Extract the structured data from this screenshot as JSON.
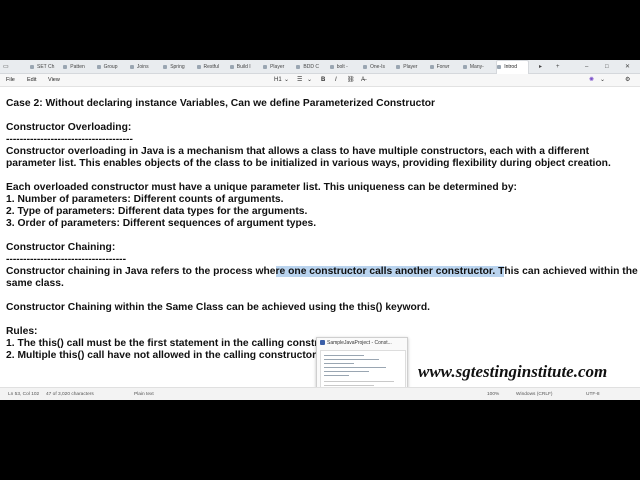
{
  "tabs": [
    "SET Ch",
    "Patten",
    "Group",
    "Joins",
    "Spring",
    "Restful",
    "Build I",
    "Player",
    "BDD C",
    "bolt -",
    "One-Is",
    "Player",
    "Forwr",
    "Many-",
    "Introd"
  ],
  "active_tab_index": 14,
  "window_controls": {
    "new_tab": "+",
    "minimize": "–",
    "maximize": "□",
    "close": "✕"
  },
  "menu": {
    "file": "File",
    "edit": "Edit",
    "view": "View"
  },
  "toolbar": {
    "heading": "H1",
    "list": "☰",
    "bold": "B",
    "italic": "I",
    "link": "⛓",
    "clear": "A̶"
  },
  "document": {
    "lines": [
      {
        "text": "Case 2: Without declaring instance Variables, Can we define Parameterized Constructor"
      },
      {
        "text": "Constructor Overloading:"
      },
      {
        "text": "-------------------------------------"
      },
      {
        "text": "Constructor overloading in Java is a mechanism that allows a class to have multiple constructors, each with a different"
      },
      {
        "text": "parameter list. This enables objects of the class to be initialized in various ways, providing flexibility during object creation."
      },
      {
        "text": "Each overloaded constructor must have a unique parameter list. This uniqueness can be determined by:"
      },
      {
        "text": "1. Number of parameters: Different counts of arguments."
      },
      {
        "text": "2. Type of parameters: Different data types for the arguments."
      },
      {
        "text": "3. Order of parameters: Different sequences of argument types."
      },
      {
        "text": "Constructor Chaining:"
      },
      {
        "text": "-----------------------------------"
      },
      {
        "text": "Constructor chaining in Java refers to the process where one constructor calls another constructor. This can achieved  within the"
      },
      {
        "text": "same class."
      },
      {
        "text": "Constructor Chaining within the Same Class can be achieved using the this() keyword."
      },
      {
        "text": "Rules:"
      },
      {
        "text": "1. The this() call must be the first statement in the calling constr"
      },
      {
        "text": "2. Multiple this() call have not allowed in the calling constructor."
      }
    ],
    "highlight": {
      "before": "Constructor chaining in Java refers to the process whe",
      "selected": "re one constructor calls another constructor. T",
      "after": "his can achieved  within the"
    }
  },
  "status": {
    "position": "Ln 53, Col 102",
    "chars": "47 of 3,020 characters",
    "format": "Plain text",
    "zoom": "100%",
    "line_ending": "Windows (CRLF)",
    "encoding": "UTF-8"
  },
  "preview": {
    "title": "SampleJavaProject - Const..."
  },
  "watermark": "www.sgtestinginstitute.com"
}
